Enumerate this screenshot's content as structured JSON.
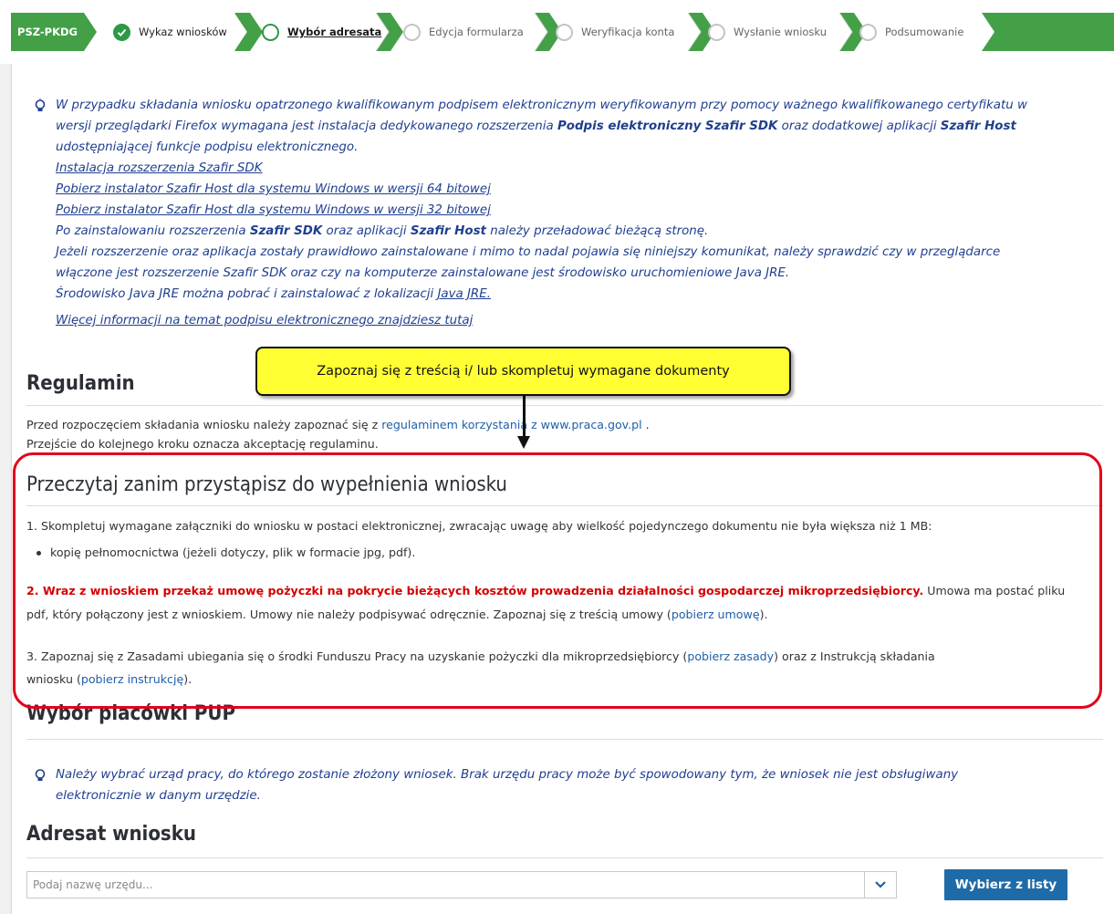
{
  "breadcrumb": {
    "tag": "PSZ-PKDG",
    "steps": [
      {
        "label": "Wykaz wniosków",
        "state": "done"
      },
      {
        "label": "Wybór adresata",
        "state": "current"
      },
      {
        "label": "Edycja formularza",
        "state": "todo"
      },
      {
        "label": "Weryfikacja konta",
        "state": "todo"
      },
      {
        "label": "Wysłanie wniosku",
        "state": "todo"
      },
      {
        "label": "Podsumowanie",
        "state": "todo"
      }
    ]
  },
  "signature_info": {
    "line1_a": "W przypadku składania wniosku opatrzonego kwalifikowanym podpisem elektronicznym weryfikowanym przy pomocy ważnego kwalifikowanego certyfikatu w",
    "line2_a": "wersji przeglądarki Firefox wymagana jest instalacja dedykowanego rozszerzenia ",
    "line2_b": "Podpis elektroniczny Szafir SDK",
    "line2_c": " oraz dodatkowej aplikacji ",
    "line2_d": "Szafir Host",
    "line3": "udostępniającej funkcje podpisu elektronicznego.",
    "link_sdk": "Instalacja rozszerzenia Szafir SDK",
    "link_64": "Pobierz instalator Szafir Host dla systemu Windows w wersji 64 bitowej",
    "link_32": "Pobierz instalator Szafir Host dla systemu Windows w wersji 32 bitowej",
    "reload_a": "Po zainstalowaniu rozszerzenia ",
    "reload_b": "Szafir SDK",
    "reload_c": " oraz aplikacji ",
    "reload_d": "Szafir Host",
    "reload_e": " należy przeładować bieżącą stronę.",
    "check1": "Jeżeli rozszerzenie oraz aplikacja zostały prawidłowo zainstalowane i mimo to nadal pojawia się niniejszy komunikat, należy sprawdzić czy w przeglądarce",
    "check2": "włączone jest rozszerzenie Szafir SDK oraz czy na komputerze zainstalowane jest środowisko uruchomieniowe Java JRE.",
    "java_a": "Środowisko Java JRE można pobrać i zainstalować z lokalizacji ",
    "java_link": "Java JRE.",
    "more_link": "Więcej informacji na temat podpisu elektronicznego znajdziesz tutaj"
  },
  "callout": "Zapoznaj się z treścią i/ lub skompletuj wymagane dokumenty",
  "regulamin": {
    "title": "Regulamin",
    "text_a": "Przed rozpoczęciem składania wniosku należy zapoznać się z ",
    "link": "regulaminem korzystania z www.praca.gov.pl",
    "text_b": " .",
    "line2": "Przejście do kolejnego kroku oznacza akceptację regulaminu."
  },
  "read": {
    "title": "Przeczytaj zanim przystąpisz do wypełnienia wniosku",
    "item1": "1. Skompletuj wymagane załączniki do wniosku w postaci elektronicznej, zwracając uwagę aby wielkość pojedynczego dokumentu nie była większa niż 1 MB:",
    "bullet1": "kopię pełnomocnictwa (jeżeli dotyczy, plik w formacie jpg, pdf).",
    "item2_red": "2. Wraz z wnioskiem przekaż umowę pożyczki na pokrycie bieżących kosztów prowadzenia działalności gospodarczej mikroprzedsiębiorcy.",
    "item2_a": " Umowa ma postać pliku",
    "item2_b": "pdf, który połączony jest z wnioskiem. Umowy nie należy podpisywać odręcznie. Zapoznaj się z treścią umowy (",
    "item2_link": "pobierz umowę",
    "item2_c": ").",
    "item3_a": "3. Zapoznaj się z Zasadami ubiegania się o środki Funduszu Pracy na uzyskanie pożyczki dla mikroprzedsiębiorcy (",
    "item3_link1": "pobierz zasady",
    "item3_b": ") oraz z Instrukcją składania",
    "item3_c": "wniosku (",
    "item3_link2": "pobierz instrukcję",
    "item3_d": ")."
  },
  "pup": {
    "title": "Wybór placówki PUP",
    "info1": "Należy wybrać urząd pracy, do którego zostanie złożony wniosek. Brak urzędu pracy może być spowodowany tym, że wniosek nie jest obsługiwany",
    "info2": "elektronicznie w danym urzędzie."
  },
  "adresat": {
    "title": "Adresat wniosku",
    "placeholder": "Podaj nazwę urzędu...",
    "button": "Wybierz z listy"
  },
  "colors": {
    "green": "#43a047",
    "red_frame": "#e3001b",
    "callout": "#ffff33",
    "button": "#1f6ba8"
  }
}
